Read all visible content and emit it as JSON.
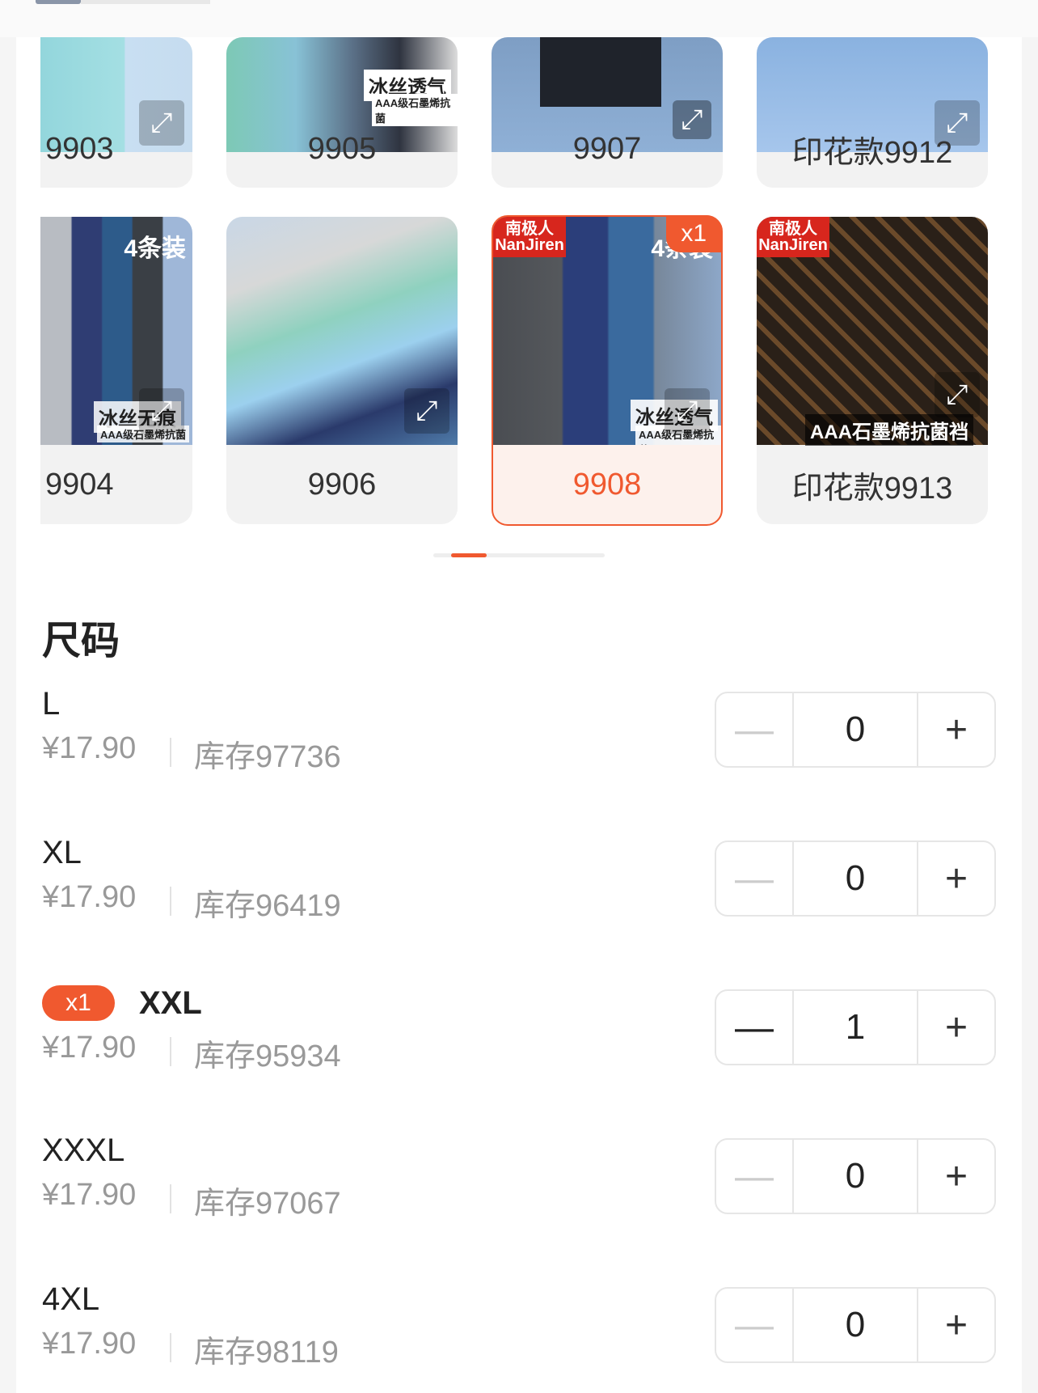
{
  "colors": {
    "accent": "#f0592f"
  },
  "variants_row1": [
    {
      "label": "9903"
    },
    {
      "label": "9905",
      "caption": "冰丝透气",
      "subcaption": "AAA级石墨烯抗菌"
    },
    {
      "label": "9907"
    },
    {
      "label": "印花款9912"
    }
  ],
  "variants_row2": [
    {
      "label": "9904",
      "caption": "冰丝无痕",
      "subcaption": "AAA级石墨烯抗菌",
      "pack": "4条装"
    },
    {
      "label": "9906"
    },
    {
      "label": "9908",
      "caption": "冰丝透气",
      "subcaption": "AAA级石墨烯抗菌",
      "badge": "x1",
      "brand": "南极人 NanJiren",
      "pack": "4条装"
    },
    {
      "label": "印花款9913",
      "caption": "AAA石墨烯抗菌裆",
      "brand": "南极人 NanJiren"
    }
  ],
  "size_section": {
    "title": "尺码"
  },
  "sizes": [
    {
      "size": "L",
      "price": "¥17.90",
      "stock": "库存97736",
      "qty": "0",
      "minus": "—",
      "plus": "+"
    },
    {
      "size": "XL",
      "price": "¥17.90",
      "stock": "库存96419",
      "qty": "0",
      "minus": "—",
      "plus": "+"
    },
    {
      "size": "XXL",
      "badge": "x1",
      "price": "¥17.90",
      "stock": "库存95934",
      "qty": "1",
      "minus": "—",
      "plus": "+"
    },
    {
      "size": "XXXL",
      "price": "¥17.90",
      "stock": "库存97067",
      "qty": "0",
      "minus": "—",
      "plus": "+"
    },
    {
      "size": "4XL",
      "price": "¥17.90",
      "stock": "库存98119",
      "qty": "0",
      "minus": "—",
      "plus": "+"
    }
  ]
}
